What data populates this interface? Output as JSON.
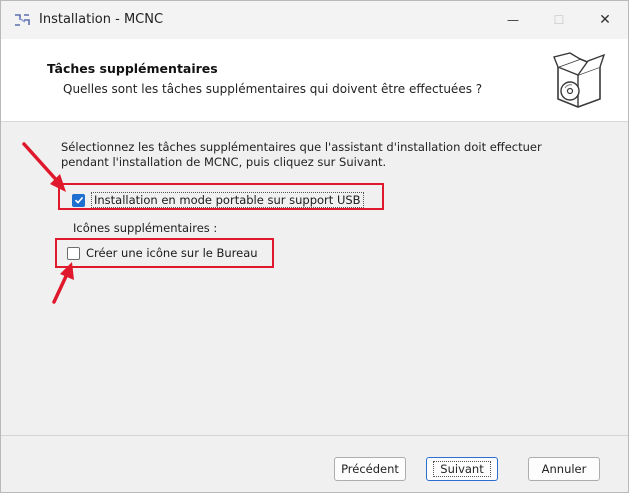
{
  "window": {
    "title": "Installation - MCNC",
    "minimize_glyph": "—",
    "maximize_glyph": "☐",
    "close_glyph": "✕"
  },
  "header": {
    "title": "Tâches supplémentaires",
    "subtitle": "Quelles sont les tâches supplémentaires qui doivent être effectuées ?",
    "icon": "software-box-icon"
  },
  "content": {
    "intro": "Sélectionnez les tâches supplémentaires que l'assistant d'installation doit effectuer pendant l'installation de MCNC, puis cliquez sur Suivant.",
    "tasks": [
      {
        "label": "Installation en mode portable sur support USB",
        "checked": true
      },
      {
        "label": "Créer une icône sur le Bureau",
        "checked": false
      }
    ],
    "extra_icons_label": "Icônes supplémentaires :"
  },
  "buttons": {
    "previous": "Précédent",
    "next": "Suivant",
    "cancel": "Annuler"
  },
  "colors": {
    "highlight": "#e0182b",
    "checkbox_checked": "#1f6fd1",
    "default_button_border": "#2a6fd0"
  }
}
